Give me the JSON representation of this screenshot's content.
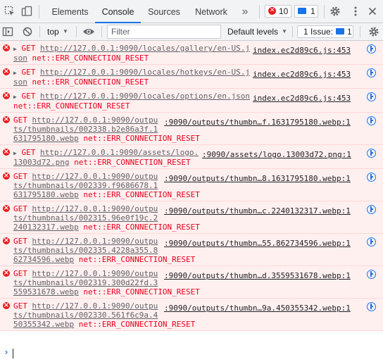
{
  "tabbar": {
    "tabs": [
      {
        "label": "Elements"
      },
      {
        "label": "Console"
      },
      {
        "label": "Sources"
      },
      {
        "label": "Network"
      }
    ],
    "more_label": "»",
    "errors_count": "10",
    "messages_count": "1"
  },
  "toolbar": {
    "context": "top",
    "filter_placeholder": "Filter",
    "levels_label": "Default levels",
    "issues_label": "1 Issue:",
    "issues_count": "1"
  },
  "messages": [
    {
      "method": "GET",
      "url_start": "http://127.0.0.1:9090/locales/gallery/en-US.j",
      "url_rest": "son",
      "error": "net::ERR_CONNECTION_RESET",
      "source": "index.ec2d89c6.js:453"
    },
    {
      "method": "GET",
      "url_start": "http://127.0.0.1:9090/locales/hotkeys/en-US.j",
      "url_rest": "son",
      "error": "net::ERR_CONNECTION_RESET",
      "source": "index.ec2d89c6.js:453"
    },
    {
      "method": "GET",
      "url_start": "http://127.0.0.1:9090/locales/options/en.json",
      "url_rest": "",
      "error": "net::ERR_CONNECTION_RESET",
      "source": "index.ec2d89c6.js:453"
    },
    {
      "method": "GET",
      "url_start": "http://127.0.0.1:9090/outpu",
      "url_mid": "ts/thumbnails/002338.b2e86a3f.1",
      "url_rest": "631795180.webp",
      "error": "net::ERR_CONNECTION_RESET",
      "source": ":9090/outputs/thumbn…f.1631795180.webp:1"
    },
    {
      "method": "GET",
      "url_start": "http://127.0.0.1:9090/assets/logo.",
      "url_rest": "13003d72.png",
      "error": "net::ERR_CONNECTION_RESET",
      "source": ":9090/assets/logo.13003d72.png:1"
    },
    {
      "method": "GET",
      "url_start": "http://127.0.0.1:9090/outpu",
      "url_mid": "ts/thumbnails/002339.f9686678.1",
      "url_rest": "631795180.webp",
      "error": "net::ERR_CONNECTION_RESET",
      "source": ":9090/outputs/thumbn…8.1631795180.webp:1"
    },
    {
      "method": "GET",
      "url_start": "http://127.0.0.1:9090/outpu",
      "url_mid": "ts/thumbnails/002315.96e0f19c.2",
      "url_rest": "240132317.webp",
      "error": "net::ERR_CONNECTION_RESET",
      "source": ":9090/outputs/thumbn…c.2240132317.webp:1"
    },
    {
      "method": "GET",
      "url_start": "http://127.0.0.1:9090/outpu",
      "url_mid": "ts/thumbnails/002335.4228a355.8",
      "url_rest": "62734596.webp",
      "error": "net::ERR_CONNECTION_RESET",
      "source": ":9090/outputs/thumbn…55.862734596.webp:1"
    },
    {
      "method": "GET",
      "url_start": "http://127.0.0.1:9090/outpu",
      "url_mid": "ts/thumbnails/002319.300d22fd.3",
      "url_rest": "559531678.webp",
      "error": "net::ERR_CONNECTION_RESET",
      "source": ":9090/outputs/thumbn…d.3559531678.webp:1"
    },
    {
      "method": "GET",
      "url_start": "http://127.0.0.1:9090/outpu",
      "url_mid": "ts/thumbnails/002330.561f6c9a.4",
      "url_rest": "50355342.webp",
      "error": "net::ERR_CONNECTION_RESET",
      "source": ":9090/outputs/thumbn…9a.450355342.webp:1"
    }
  ],
  "prompt_symbol": "›"
}
